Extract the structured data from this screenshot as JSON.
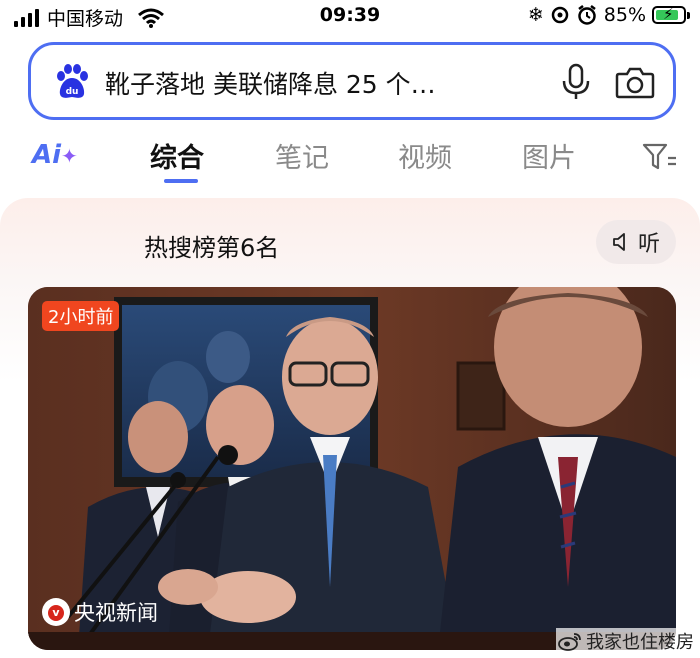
{
  "status_bar": {
    "carrier": "中国移动",
    "time": "09:39",
    "battery_percent": "85%",
    "battery_level": 0.85,
    "icons": [
      "signal-icon",
      "wifi-icon",
      "snowflake-icon",
      "focus-icon",
      "alarm-icon",
      "battery-icon"
    ]
  },
  "search": {
    "query": "靴子落地 美联储降息 25 个…",
    "icons": [
      "baidu-paw-icon",
      "mic-icon",
      "camera-icon"
    ]
  },
  "tabs": {
    "ai_label": "Ai",
    "items": [
      {
        "label": "综合",
        "active": true
      },
      {
        "label": "笔记",
        "active": false
      },
      {
        "label": "视频",
        "active": false
      },
      {
        "label": "图片",
        "active": false
      }
    ],
    "accent": "#4e6ef2"
  },
  "hot": {
    "rank_label": "热搜榜第6名",
    "listen_label": "听"
  },
  "news": {
    "time_badge": "2小时前",
    "source": "央视新闻",
    "badge_color": "#f0461f"
  },
  "watermark": {
    "text": "我家也住楼房"
  }
}
